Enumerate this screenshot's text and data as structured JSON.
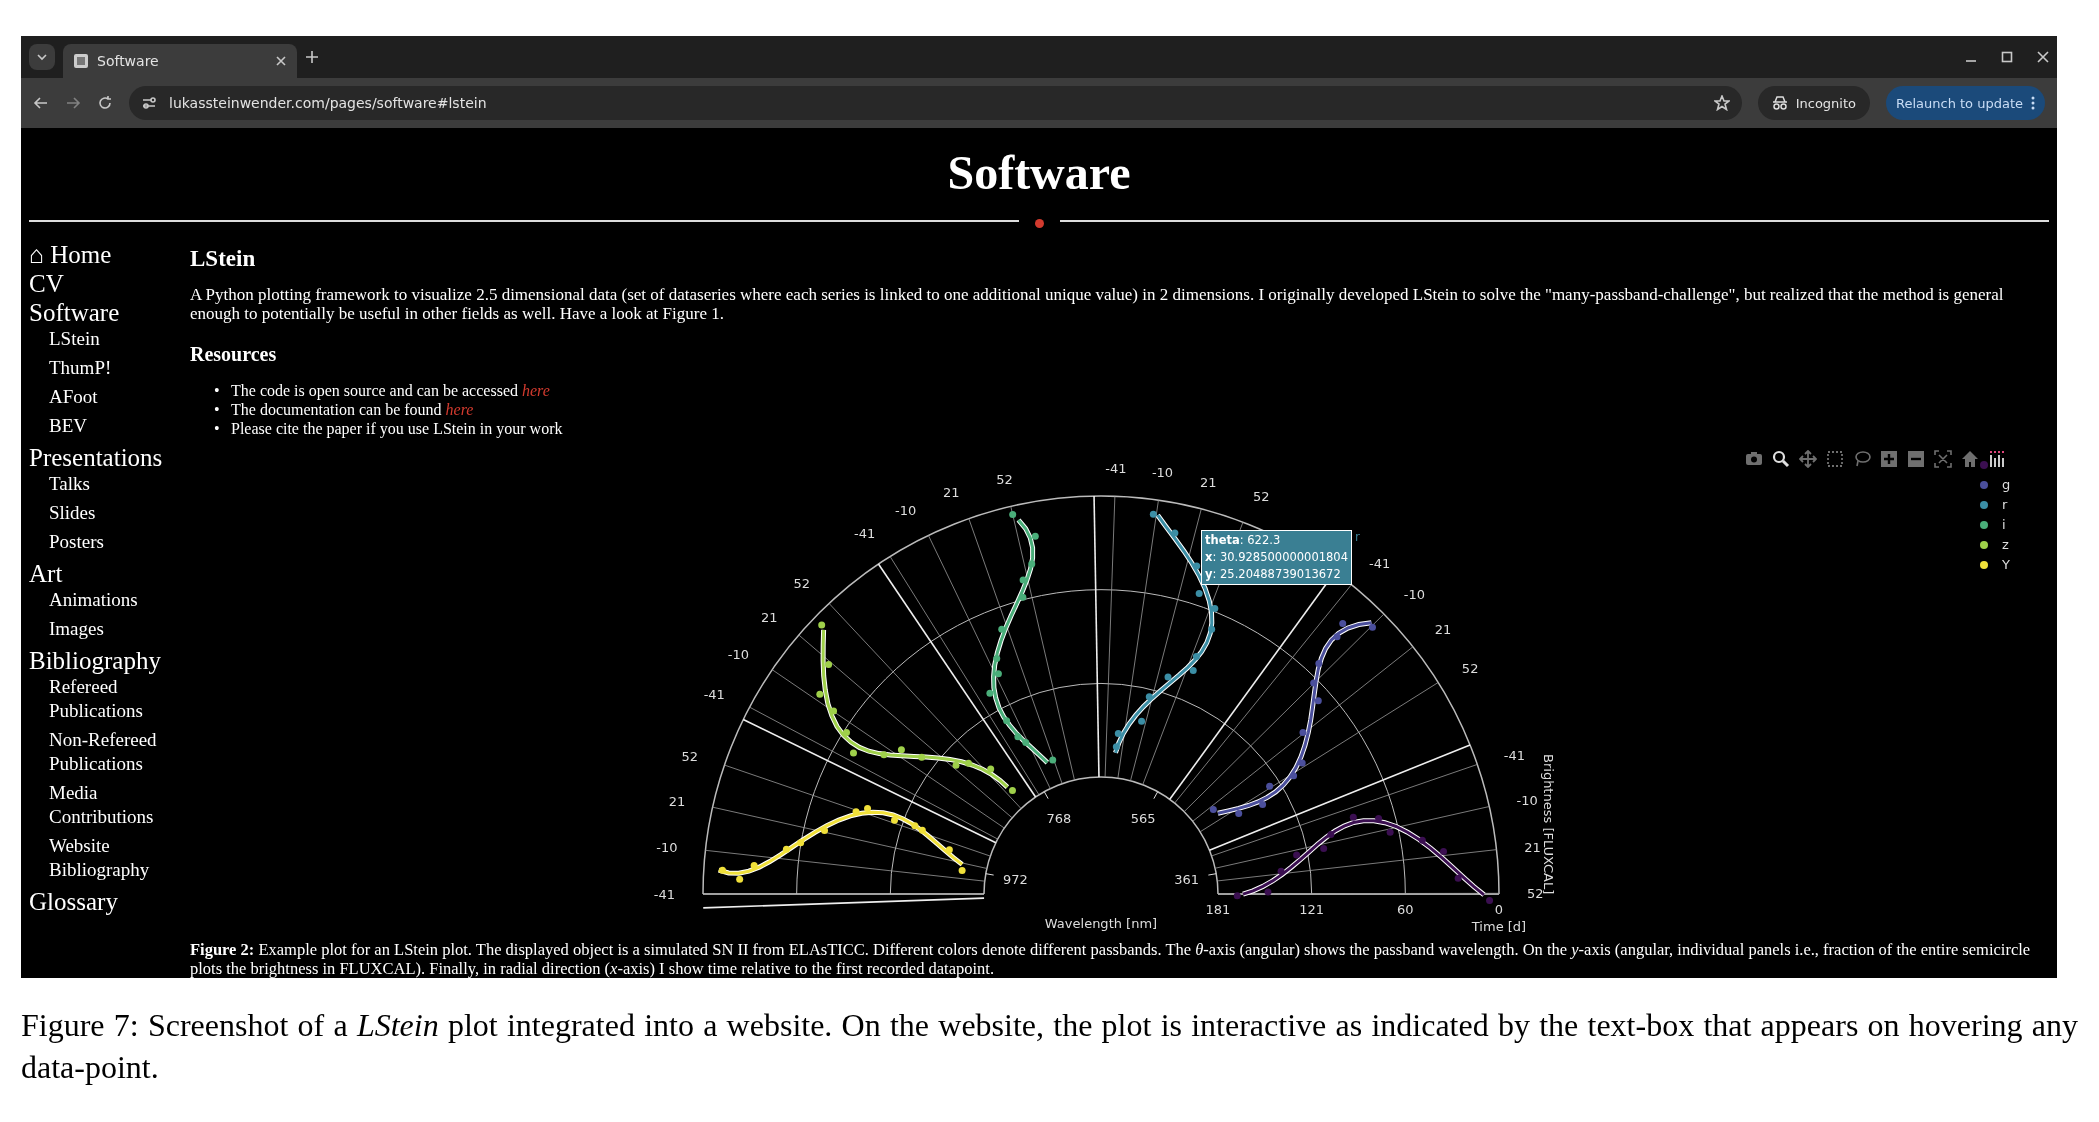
{
  "browser": {
    "tab_title": "Software",
    "url": "lukassteinwender.com/pages/software#lstein",
    "incognito": "Incognito",
    "relaunch": "Relaunch to update"
  },
  "page": {
    "title": "Software",
    "nav": [
      {
        "label": "⌂ Home"
      },
      {
        "label": "CV"
      },
      {
        "label": "Software",
        "children": [
          {
            "label": "LStein"
          },
          {
            "label": "ThumP!"
          },
          {
            "label": "AFoot"
          },
          {
            "label": "BEV"
          }
        ]
      },
      {
        "label": "Presentations",
        "children": [
          {
            "label": "Talks"
          },
          {
            "label": "Slides"
          },
          {
            "label": "Posters"
          }
        ]
      },
      {
        "label": "Art",
        "children": [
          {
            "label": "Animations"
          },
          {
            "label": "Images"
          }
        ]
      },
      {
        "label": "Bibliography",
        "children": [
          {
            "label": "Refereed Publications"
          },
          {
            "label": "Non-Refereed Publications"
          },
          {
            "label": "Media Contributions"
          },
          {
            "label": "Website Bibliography"
          }
        ]
      },
      {
        "label": "Glossary"
      }
    ],
    "heading": "LStein",
    "intro": "A Python plotting framework to visualize 2.5 dimensional data (set of dataseries where each series is linked to one additional unique value) in 2 dimensions. I originally developed LStein to solve the \"many-passband-challenge\", but realized that the method is general enough to potentially be useful in other fields as well. Have a look at Figure 1.",
    "resources_heading": "Resources",
    "resources": [
      {
        "marker": "•",
        "text": "The code is open source and can be accessed ",
        "link": "here"
      },
      {
        "marker": "•",
        "text": "The documentation can be found ",
        "link": "here"
      },
      {
        "marker": "•",
        "text": "Please cite the paper if you use LStein in your work"
      }
    ],
    "plot": {
      "modebar": [
        {
          "kind": "camera",
          "selected": false
        },
        {
          "kind": "zoom",
          "selected": true
        },
        {
          "kind": "pan",
          "selected": false
        },
        {
          "kind": "box-select",
          "selected": false
        },
        {
          "kind": "lasso",
          "selected": false
        },
        {
          "kind": "zoom-in",
          "selected": false
        },
        {
          "kind": "zoom-out",
          "selected": false
        },
        {
          "kind": "autoscale",
          "selected": false
        },
        {
          "kind": "home",
          "selected": false
        },
        {
          "kind": "logo",
          "selected": false
        }
      ],
      "legend": [
        {
          "color": "#3b0f51"
        },
        {
          "name": "g",
          "color": "#4b4f9c"
        },
        {
          "name": "r",
          "color": "#3b8ea5"
        },
        {
          "name": "i",
          "color": "#4aae7a"
        },
        {
          "name": "z",
          "color": "#9fd04a"
        },
        {
          "name": "Y",
          "color": "#f0e03a"
        }
      ],
      "panels": [
        {
          "ticks": [
            "-41",
            "-10",
            "21",
            "52"
          ]
        },
        {
          "ticks": [
            "-41",
            "-10",
            "21",
            "52"
          ]
        },
        {
          "ticks": [
            "-41",
            "-10",
            "21",
            "52"
          ]
        },
        {
          "ticks": [
            "-41",
            "-10",
            "21",
            "52"
          ]
        },
        {
          "ticks": [
            "-41",
            "-10",
            "21",
            "52"
          ]
        },
        {
          "ticks": [
            "-41",
            "-10",
            "21",
            "52"
          ]
        }
      ],
      "wavelength_ticks": [
        "972",
        "768",
        "565",
        "361"
      ],
      "time_ticks": [
        "181",
        "121",
        "60",
        "0"
      ],
      "xlabel": "Wavelength [nm]",
      "time_label": "Time [d]",
      "ylabel": "Brightness [FLUXCAL]",
      "tooltip": {
        "lines": [
          "**theta**: 622.3",
          "**x**: 30.928500000001804",
          "**y**: 25.20488739013672"
        ],
        "trace": "r"
      }
    },
    "figure_caption": "**Figure 2:** Example plot for an LStein plot. The displayed object is a simulated SN II from ELAsTICC. Different colors denote different passbands. The *θ*-axis (angular) shows the passband wavelength. On the *y*-axis (angular, individual panels i.e., fraction of the entire semicircle plots the brightness in FLUXCAL). Finally, in radial direction (*x*-axis) I show time relative to the first recorded datapoint."
  },
  "caption": "Figure 7: Screenshot of a *LStein* plot integrated into a website. On the website, the plot is interactive as indicated by the text-box that appears on hovering any data-point."
}
